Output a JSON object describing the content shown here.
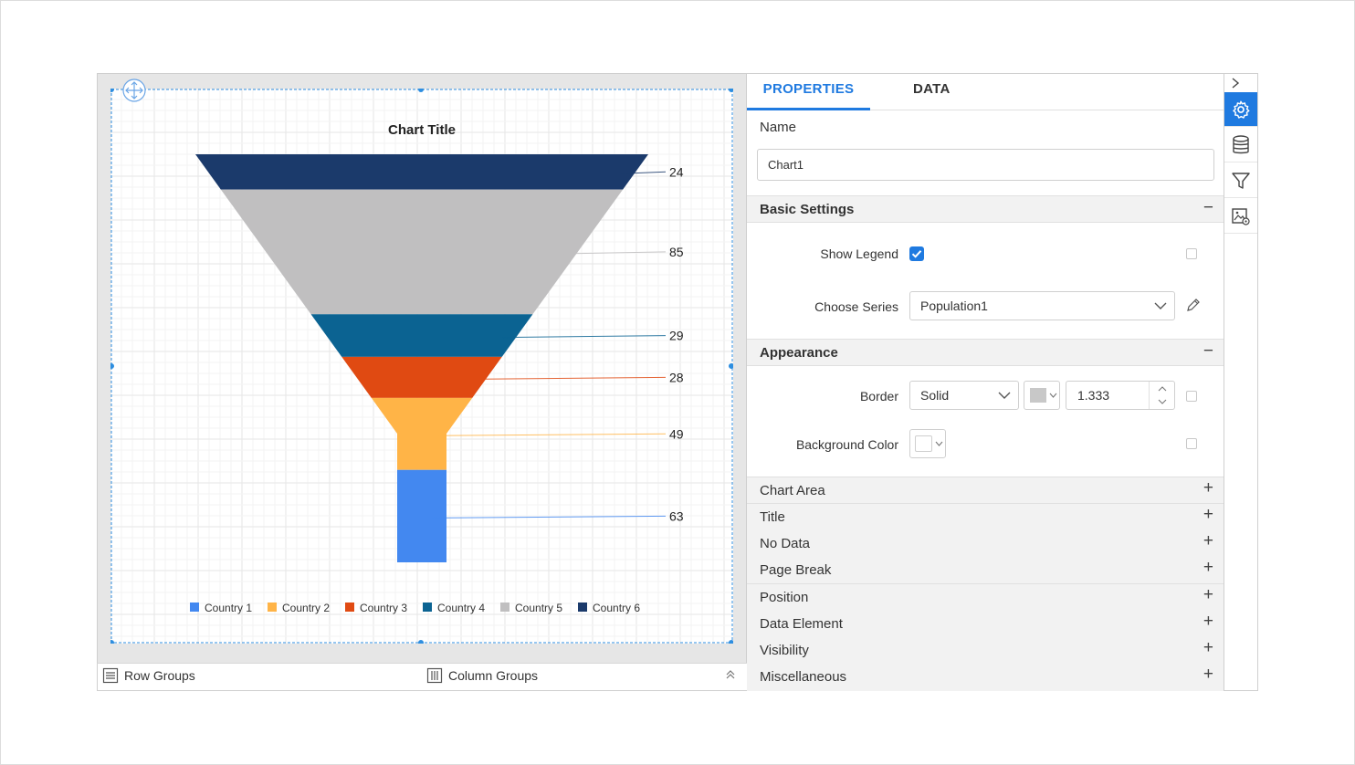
{
  "chart": {
    "title": "Chart Title"
  },
  "chart_data": {
    "type": "funnel",
    "title": "Chart Title",
    "categories": [
      "Country 1",
      "Country 2",
      "Country 3",
      "Country 4",
      "Country 5",
      "Country 6"
    ],
    "values": [
      63,
      49,
      28,
      29,
      85,
      24
    ],
    "colors": [
      "#4388f0",
      "#ffb447",
      "#e04a12",
      "#0b6392",
      "#c0bfc0",
      "#1b3a6b"
    ],
    "data_labels": [
      "63",
      "49",
      "28",
      "29",
      "85",
      "24"
    ],
    "legend": {
      "position": "bottom"
    },
    "grid": true
  },
  "designer": {
    "row_groups_label": "Row Groups",
    "column_groups_label": "Column Groups"
  },
  "panel": {
    "tabs": [
      {
        "label": "PROPERTIES",
        "active": true
      },
      {
        "label": "DATA",
        "active": false
      }
    ],
    "name_label": "Name",
    "name_value": "Chart1",
    "basic_settings": {
      "title": "Basic Settings",
      "show_legend_label": "Show Legend",
      "show_legend_checked": true,
      "choose_series_label": "Choose Series",
      "choose_series_value": "Population1"
    },
    "appearance": {
      "title": "Appearance",
      "border_label": "Border",
      "border_style": "Solid",
      "border_width": "1.333",
      "background_label": "Background Color"
    },
    "collapsed_sections": [
      "Chart Area",
      "Title",
      "No Data",
      "Page Break",
      "Position",
      "Data Element",
      "Visibility",
      "Miscellaneous"
    ],
    "minus_sign": "−",
    "plus_sign": "+"
  },
  "rail": {
    "icons": [
      "settings-icon",
      "database-icon",
      "filter-icon",
      "image-settings-icon"
    ],
    "accent": "#1f7ae0"
  }
}
